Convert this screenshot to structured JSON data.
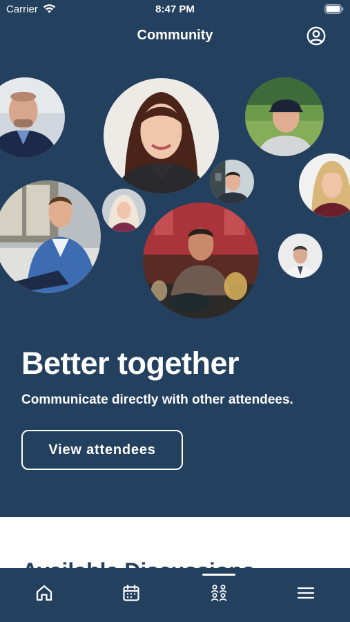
{
  "status_bar": {
    "carrier": "Carrier",
    "time": "8:47 PM"
  },
  "nav": {
    "title": "Community",
    "profile_icon": "person-circle-icon"
  },
  "hero": {
    "headline": "Better together",
    "subline": "Communicate directly with other attendees.",
    "button_label": "View attendees"
  },
  "section_peek": {
    "title": "Available Discussions"
  },
  "tab_bar": {
    "tabs": [
      {
        "icon": "home-icon",
        "selected": false
      },
      {
        "icon": "calendar-icon",
        "selected": false
      },
      {
        "icon": "people-icon",
        "selected": true
      },
      {
        "icon": "menu-icon",
        "selected": false
      }
    ]
  },
  "colors": {
    "primary": "#24405f",
    "on_primary": "#ffffff",
    "background": "#ffffff"
  }
}
